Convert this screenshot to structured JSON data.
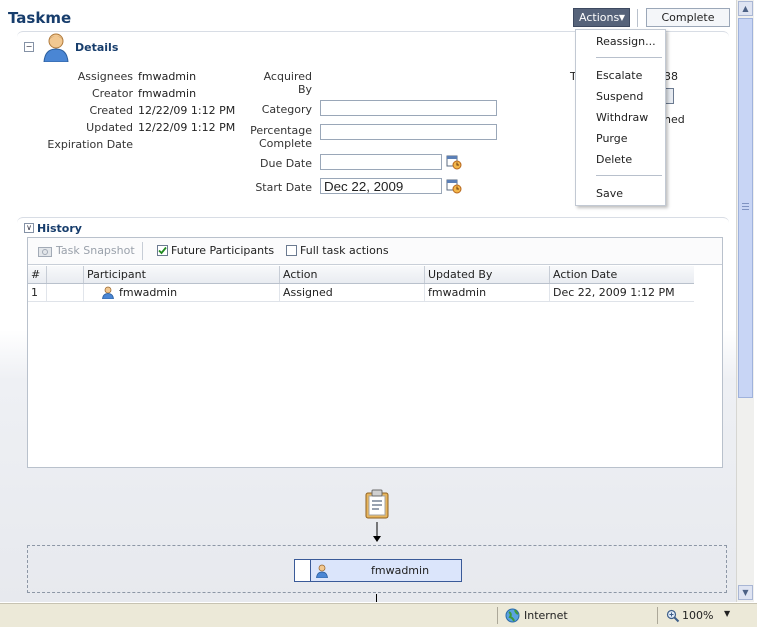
{
  "window": {
    "title": "Taskme"
  },
  "toolbar": {
    "actions_label": "Actions",
    "complete_label": "Complete"
  },
  "details": {
    "title": "Details",
    "fields_left": [
      {
        "label": "Assignees",
        "value": "fmwadmin"
      },
      {
        "label": "Creator",
        "value": "fmwadmin"
      },
      {
        "label": "Created",
        "value": "12/22/09 1:12 PM"
      },
      {
        "label": "Updated",
        "value": "12/22/09 1:12 PM"
      },
      {
        "label": "Expiration Date",
        "value": ""
      }
    ],
    "acquired_by_line1": "Acquired",
    "acquired_by_line2": "By",
    "category_label": "Category",
    "category_value": "",
    "pct_line1": "Percentage",
    "pct_line2": "Complete",
    "pct_value": "",
    "due_date_label": "Due Date",
    "due_date_value": "",
    "start_date_label": "Start Date",
    "start_date_value": "Dec 22, 2009",
    "partial_right": {
      "letter": "T",
      "number": "38",
      "suffix": "ned"
    }
  },
  "actions_menu": {
    "items": [
      "Reassign...",
      "Escalate",
      "Suspend",
      "Withdraw",
      "Purge",
      "Delete",
      "Save"
    ]
  },
  "history": {
    "title": "History",
    "task_snapshot_label": "Task Snapshot",
    "future_participants_label": "Future Participants",
    "future_participants_checked": true,
    "full_task_actions_label": "Full task actions",
    "full_task_actions_checked": false,
    "columns": [
      "#",
      "Participant",
      "Action",
      "Updated By",
      "Action Date"
    ],
    "rows": [
      {
        "num": "1",
        "participant": "fmwadmin",
        "action": "Assigned",
        "updated_by": "fmwadmin",
        "action_date": "Dec 22, 2009 1:12 PM"
      }
    ]
  },
  "flow": {
    "node_label": "fmwadmin"
  },
  "statusbar": {
    "zone": "Internet",
    "zoom": "100%"
  }
}
